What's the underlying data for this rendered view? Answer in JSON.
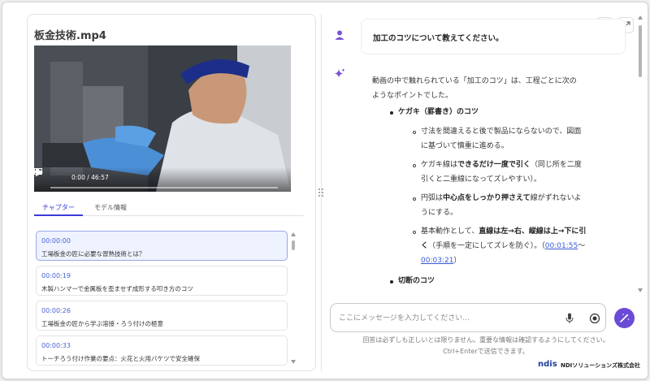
{
  "video": {
    "title": "板金技術.mp4",
    "time": "0:00 / 46:57"
  },
  "tabs": [
    {
      "label": "チャプター",
      "active": true
    },
    {
      "label": "モデル情報",
      "active": false
    }
  ],
  "chapters": [
    {
      "time": "00:00:00",
      "title": "工場板金の匠に必要な習熟技術とは？",
      "selected": true
    },
    {
      "time": "00:00:19",
      "title": "木製ハンマーで金属板を歪ませず成形する叩き方のコツ",
      "selected": false
    },
    {
      "time": "00:00:26",
      "title": "工場板金の匠から学ぶ溶接・ろう付けの極意",
      "selected": false
    },
    {
      "time": "00:00:33",
      "title": "トーチろう付け作業の要点：火花と火用バケツで安全確保",
      "selected": false
    }
  ],
  "chat": {
    "user_message": "加工のコツについて教えてください。",
    "answer": {
      "intro_1": "動画の中で触れられている「加工のコツ」は、工程ごとに次の",
      "intro_2": "ようなポイントでした。",
      "section1_title": "ケガキ（罫書き）のコツ",
      "item1_1": "寸法を間違えると後で製品にならないので、図面",
      "item1_2": "に基づいて慎重に進める。",
      "item2_a": "ケガキ線は",
      "item2_b": "できるだけ一度で引く",
      "item2_c": "（同じ所を二度",
      "item2_2": "引くと二重線になってズレやすい）。",
      "item3_a": "円弧は",
      "item3_b": "中心点をしっかり押さえて",
      "item3_c": "線がずれないよ",
      "item3_2": "うにする。",
      "item4_a": "基本動作として、",
      "item4_b": "直線は左→右、縦線は上→下に引",
      "item4_c": "く",
      "item4_d": "（手順を一定にしてズレを防ぐ）。（",
      "item4_link1": "00:01:55",
      "item4_tilde": "〜",
      "item4_link2": "00:03:21",
      "item4_close": "）",
      "section2_title": "切断のコツ"
    }
  },
  "input": {
    "placeholder": "ここにメッセージを入力してください..."
  },
  "footer": {
    "disclaimer": "回答は必ずしも正しいとは限りません。重要な情報は確認するようにしてください。",
    "hint": "Ctrl+Enterで送信できます。",
    "logo_mark": "ndis",
    "company": "NDIソリューションズ株式会社"
  },
  "colors": {
    "accent": "#3b3bd8",
    "link": "#3b5ad8",
    "send_button": "#6b4bd6",
    "avatar": "#7b52d8"
  },
  "icons": {
    "user": "user-avatar-icon",
    "ai": "sparkle-icon",
    "swap": "swap-icon",
    "expand": "expand-icon",
    "mic": "mic-icon",
    "stop": "stop-icon",
    "send": "magic-wand-icon"
  }
}
